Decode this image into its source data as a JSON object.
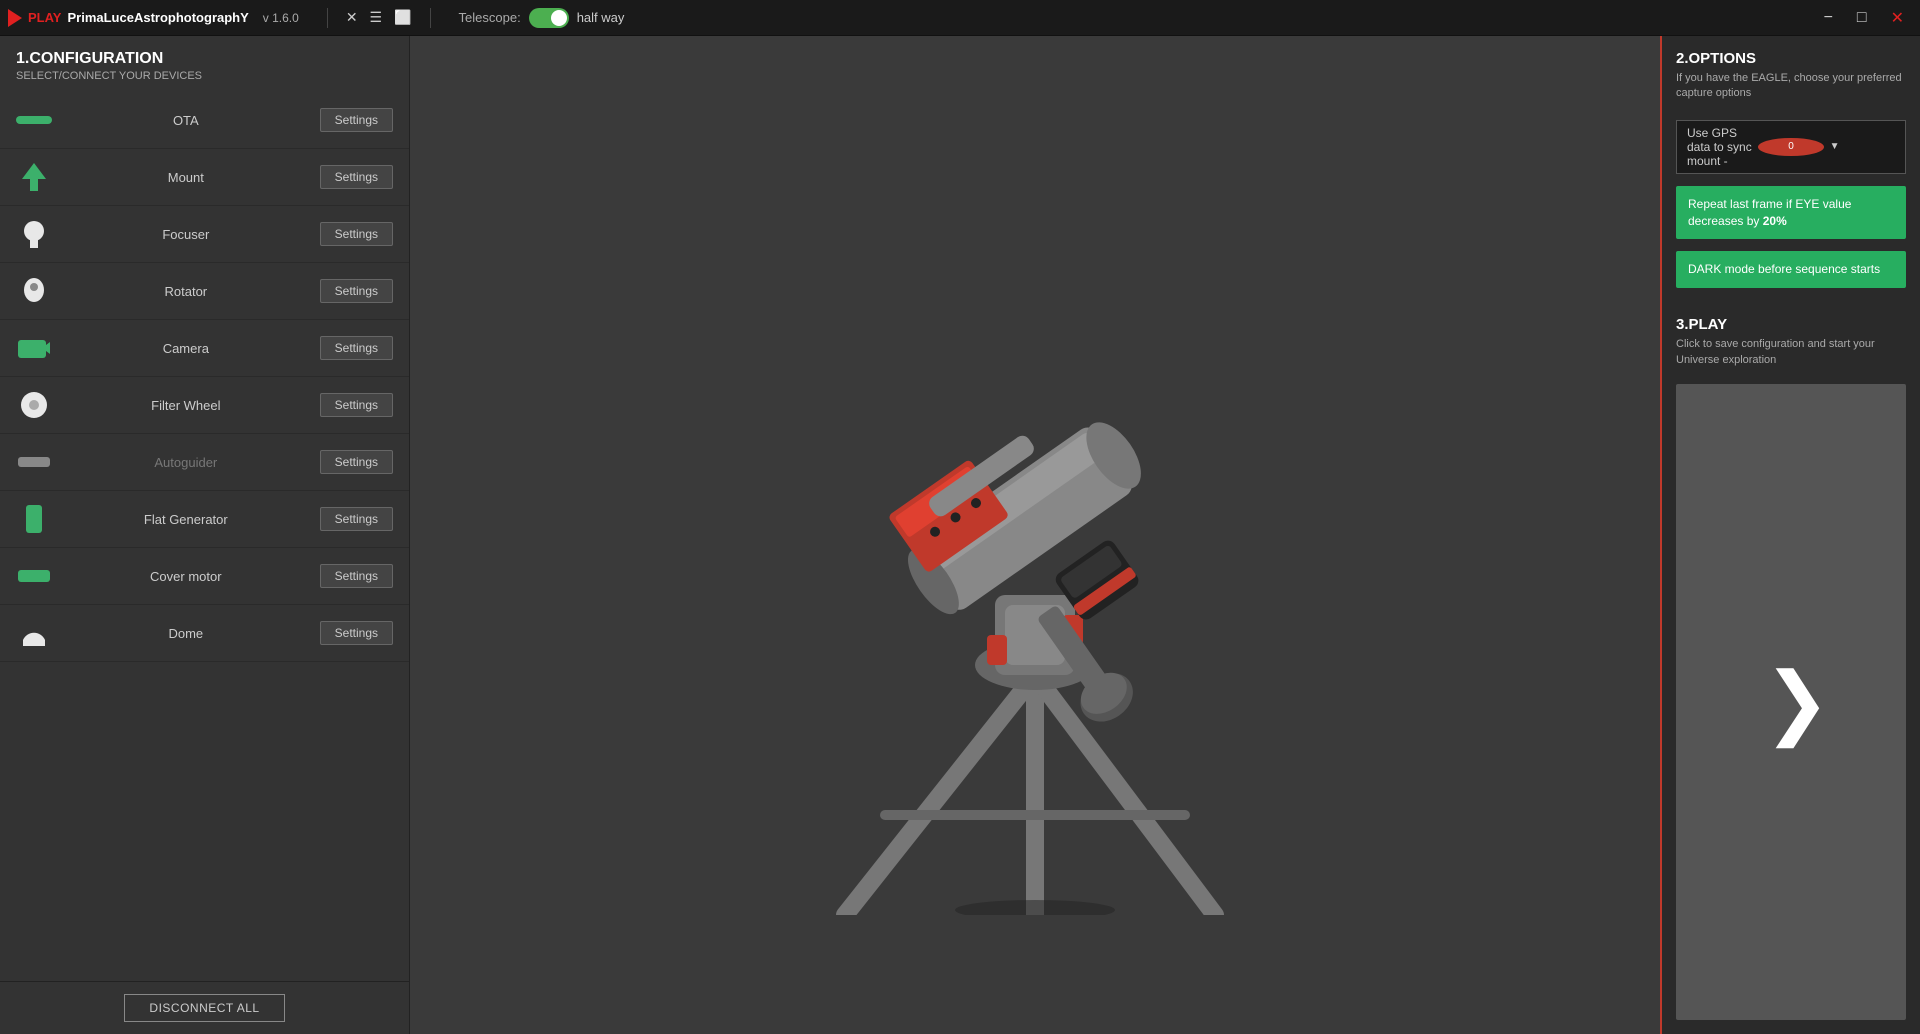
{
  "titlebar": {
    "brand": "PrimaLuceAstrophotographY",
    "play_label": "PLAY",
    "version": "v 1.6.0",
    "telescope_label": "Telescope:",
    "telescope_status": "half way",
    "minimize_label": "−",
    "maximize_label": "□",
    "close_label": "✕"
  },
  "left": {
    "section_title": "1.CONFIGURATION",
    "section_subtitle": "SELECT/CONNECT YOUR DEVICES",
    "devices": [
      {
        "id": "ota",
        "name": "OTA",
        "icon_type": "ota",
        "dimmed": false
      },
      {
        "id": "mount",
        "name": "Mount",
        "icon_type": "mount",
        "dimmed": false
      },
      {
        "id": "focuser",
        "name": "Focuser",
        "icon_type": "focuser",
        "dimmed": false
      },
      {
        "id": "rotator",
        "name": "Rotator",
        "icon_type": "rotator",
        "dimmed": false
      },
      {
        "id": "camera",
        "name": "Camera",
        "icon_type": "camera",
        "dimmed": false
      },
      {
        "id": "filter-wheel",
        "name": "Filter Wheel",
        "icon_type": "filterwheel",
        "dimmed": false
      },
      {
        "id": "autoguider",
        "name": "Autoguider",
        "icon_type": "autoguider",
        "dimmed": true
      },
      {
        "id": "flat-generator",
        "name": "Flat Generator",
        "icon_type": "flatgen",
        "dimmed": false
      },
      {
        "id": "cover-motor",
        "name": "Cover motor",
        "icon_type": "covermotor",
        "dimmed": false
      },
      {
        "id": "dome",
        "name": "Dome",
        "icon_type": "dome",
        "dimmed": false
      }
    ],
    "settings_label": "Settings",
    "disconnect_all_label": "DISCONNECT ALL"
  },
  "right": {
    "options_title": "2.OPTIONS",
    "options_desc": "If you have the EAGLE, choose your preferred capture options",
    "gps_label": "Use GPS data to sync mount -",
    "gps_badge": "0",
    "repeat_frame_label": "Repeat last frame if EYE value decreases by ",
    "repeat_frame_bold": "20%",
    "dark_mode_label": "DARK mode before sequence starts",
    "play_title": "3.PLAY",
    "play_desc": "Click to save configuration and start your Universe exploration",
    "play_icon": "❯"
  }
}
